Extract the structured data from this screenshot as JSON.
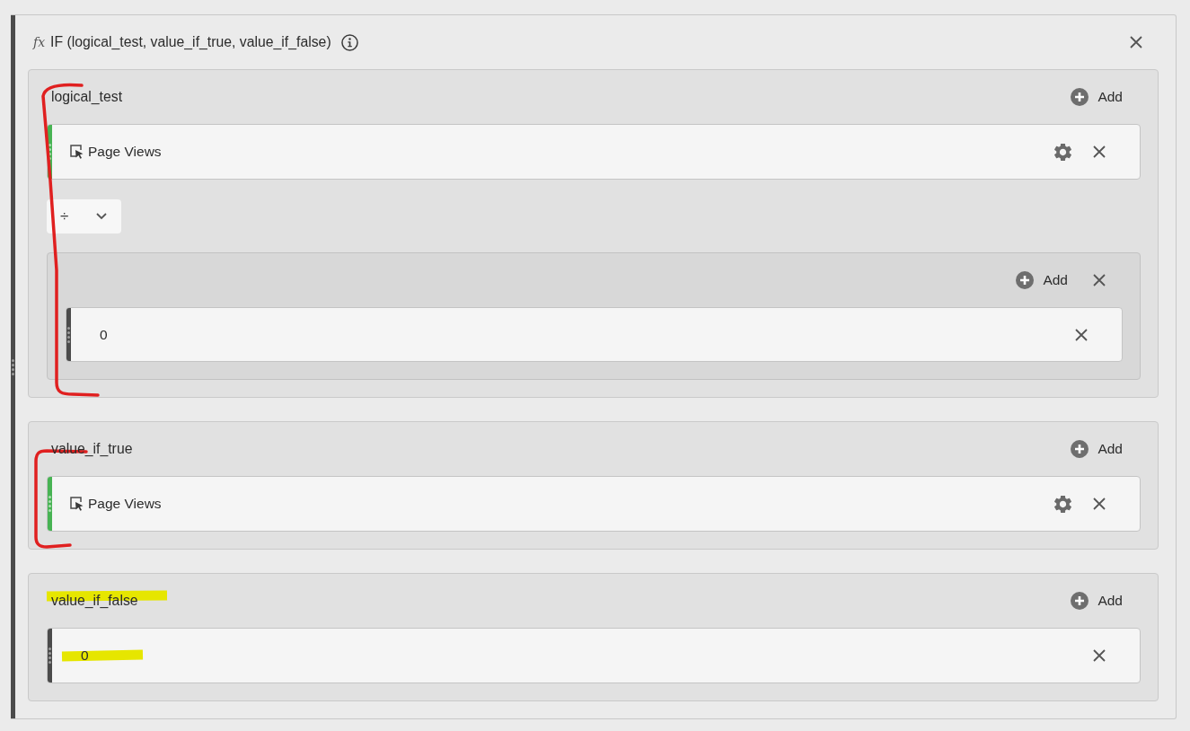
{
  "panel": {
    "function_symbol": "fx",
    "title": "IF (logical_test, value_if_true, value_if_false)"
  },
  "arguments": [
    {
      "label": "logical_test",
      "add_label": "Add",
      "annotation": {
        "kind": "bracket",
        "color": "#e02020"
      },
      "items": [
        {
          "kind": "metric",
          "name": "Page Views",
          "color": "#47b353"
        },
        {
          "kind": "operator",
          "symbol": "÷"
        },
        {
          "kind": "group",
          "add_label": "Add",
          "items": [
            {
              "kind": "number",
              "value": "0",
              "color": "#4b4b4b"
            }
          ]
        }
      ]
    },
    {
      "label": "value_if_true",
      "add_label": "Add",
      "annotation": {
        "kind": "bracket",
        "color": "#e02020"
      },
      "items": [
        {
          "kind": "metric",
          "name": "Page Views",
          "color": "#47b353"
        }
      ]
    },
    {
      "label": "value_if_false",
      "add_label": "Add",
      "annotation": {
        "kind": "highlight",
        "color": "#e6e600"
      },
      "items": [
        {
          "kind": "number",
          "value": "0",
          "color": "#4b4b4b"
        }
      ]
    }
  ]
}
